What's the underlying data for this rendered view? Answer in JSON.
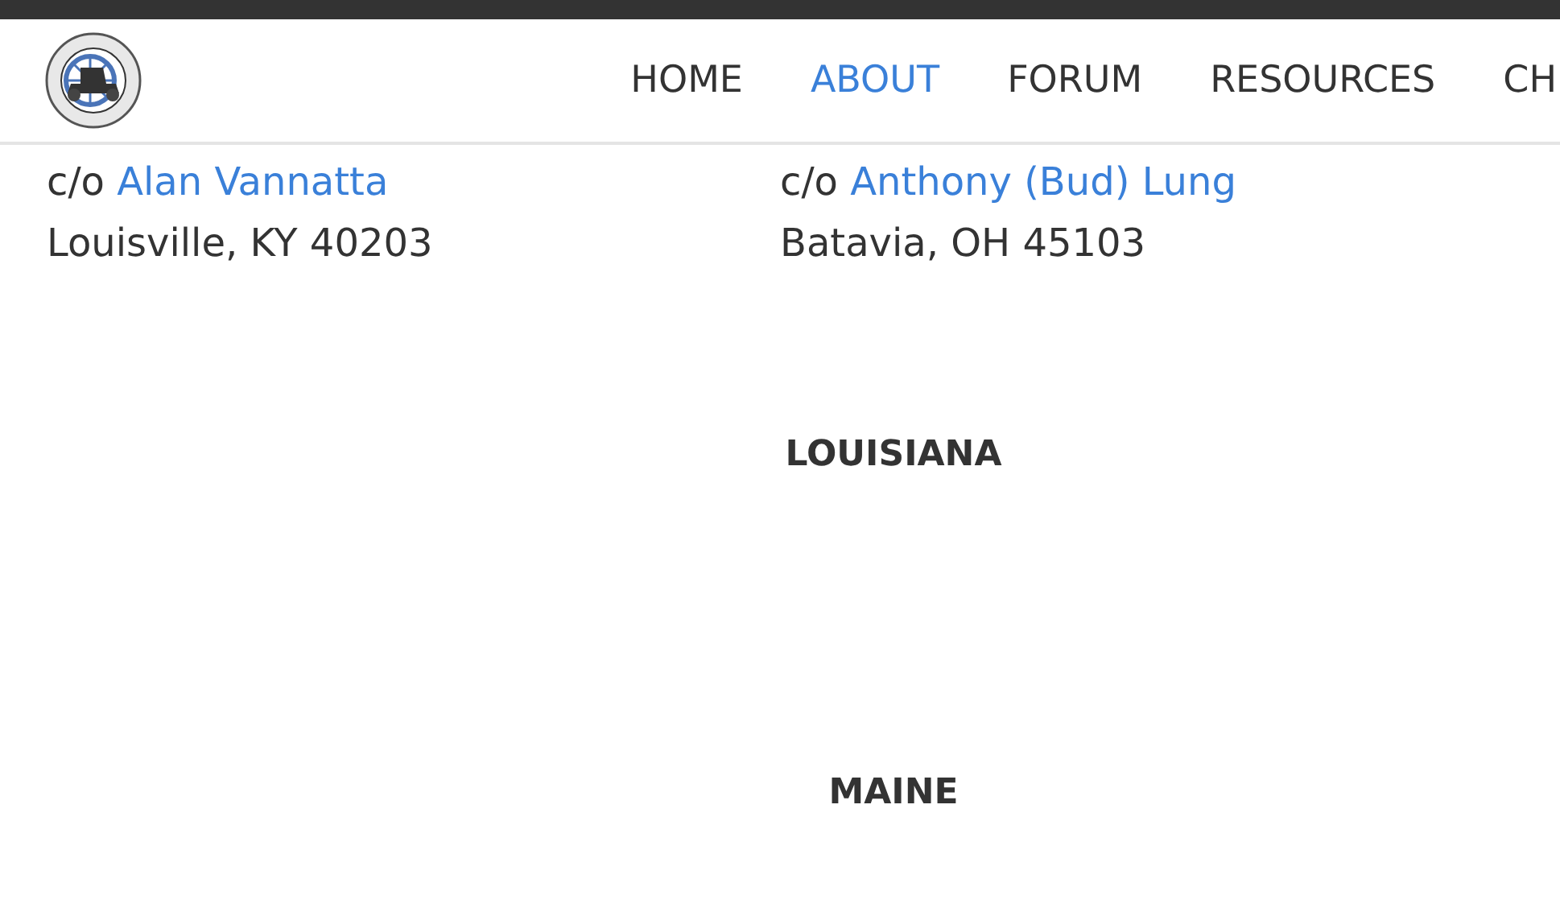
{
  "nav": {
    "items": [
      {
        "label": "HOME",
        "selected": false
      },
      {
        "label": "ABOUT",
        "selected": true
      },
      {
        "label": "FORUM",
        "selected": false
      },
      {
        "label": "RESOURCES",
        "selected": false
      },
      {
        "label": "CH",
        "selected": false
      }
    ]
  },
  "addresses": [
    {
      "prefix": "c/o ",
      "contact": "Alan Vannatta",
      "city": "Louisville, KY 40203"
    },
    {
      "prefix": "c/o ",
      "contact": "Anthony (Bud) Lung",
      "city": "Batavia, OH 45103"
    }
  ],
  "sections": [
    "LOUISIANA",
    "MAINE"
  ]
}
